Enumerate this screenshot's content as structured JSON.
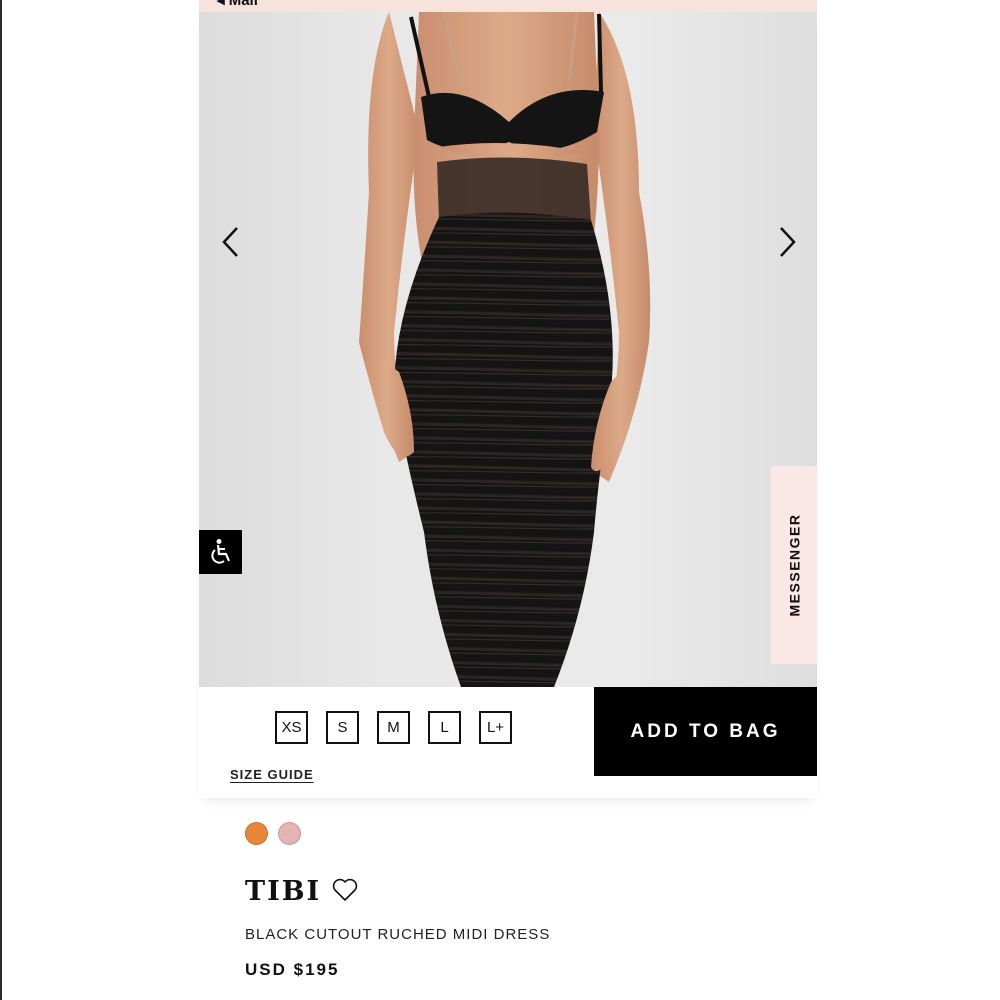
{
  "header": {
    "back_label": "◂ Mail"
  },
  "hero": {
    "prev_icon": "chevron-left-icon",
    "next_icon": "chevron-right-icon",
    "accessibility_icon": "wheelchair-icon"
  },
  "messenger": {
    "label": "MESSENGER"
  },
  "sizes": [
    "XS",
    "S",
    "M",
    "L",
    "L+"
  ],
  "size_guide_label": "SIZE GUIDE",
  "add_to_bag_label": "ADD TO BAG",
  "swatches": [
    {
      "color": "#e8873a"
    },
    {
      "color": "#e6b3b4"
    }
  ],
  "product": {
    "brand": "TIBI",
    "name": "BLACK CUTOUT RUCHED MIDI DRESS",
    "price": "USD $195"
  },
  "colors": {
    "accent_black": "#000000",
    "header_pink": "#f7e2dc",
    "messenger_pink": "#fbe7e6"
  }
}
